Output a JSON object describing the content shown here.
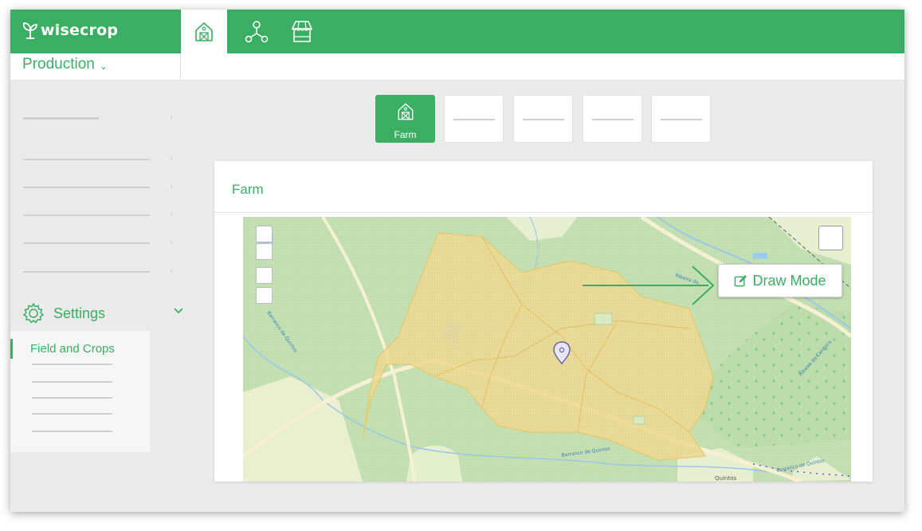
{
  "brand": {
    "name": "wisecrop"
  },
  "header": {
    "nav_tabs": [
      {
        "icon": "farm-barn-icon",
        "active": true
      },
      {
        "icon": "network-nodes-icon",
        "active": false
      },
      {
        "icon": "market-stall-icon",
        "active": false
      }
    ]
  },
  "subbar": {
    "module": "Production"
  },
  "sidebar": {
    "settings_label": "Settings",
    "settings_submenu_active": "Field and Crops"
  },
  "steps": [
    {
      "label": "Farm",
      "active": true,
      "icon": "farm-barn-icon"
    },
    {
      "label": "",
      "active": false
    },
    {
      "label": "",
      "active": false
    },
    {
      "label": "",
      "active": false
    },
    {
      "label": "",
      "active": false
    }
  ],
  "panel": {
    "title": "Farm",
    "draw_mode_label": "Draw Mode"
  },
  "map_labels": {
    "creek_1": "Barranco de Quintos",
    "creek_2": "Barranco de Quintos",
    "creek_3": "Barranco de Quintos",
    "creek_4": "Ribeira da Cardeira",
    "road": "Ribeira da...",
    "place": "Quintos"
  },
  "colors": {
    "accent": "#3aae62",
    "farm_polygon": "#f3dc8f",
    "map_green": "#cfe6c2"
  }
}
